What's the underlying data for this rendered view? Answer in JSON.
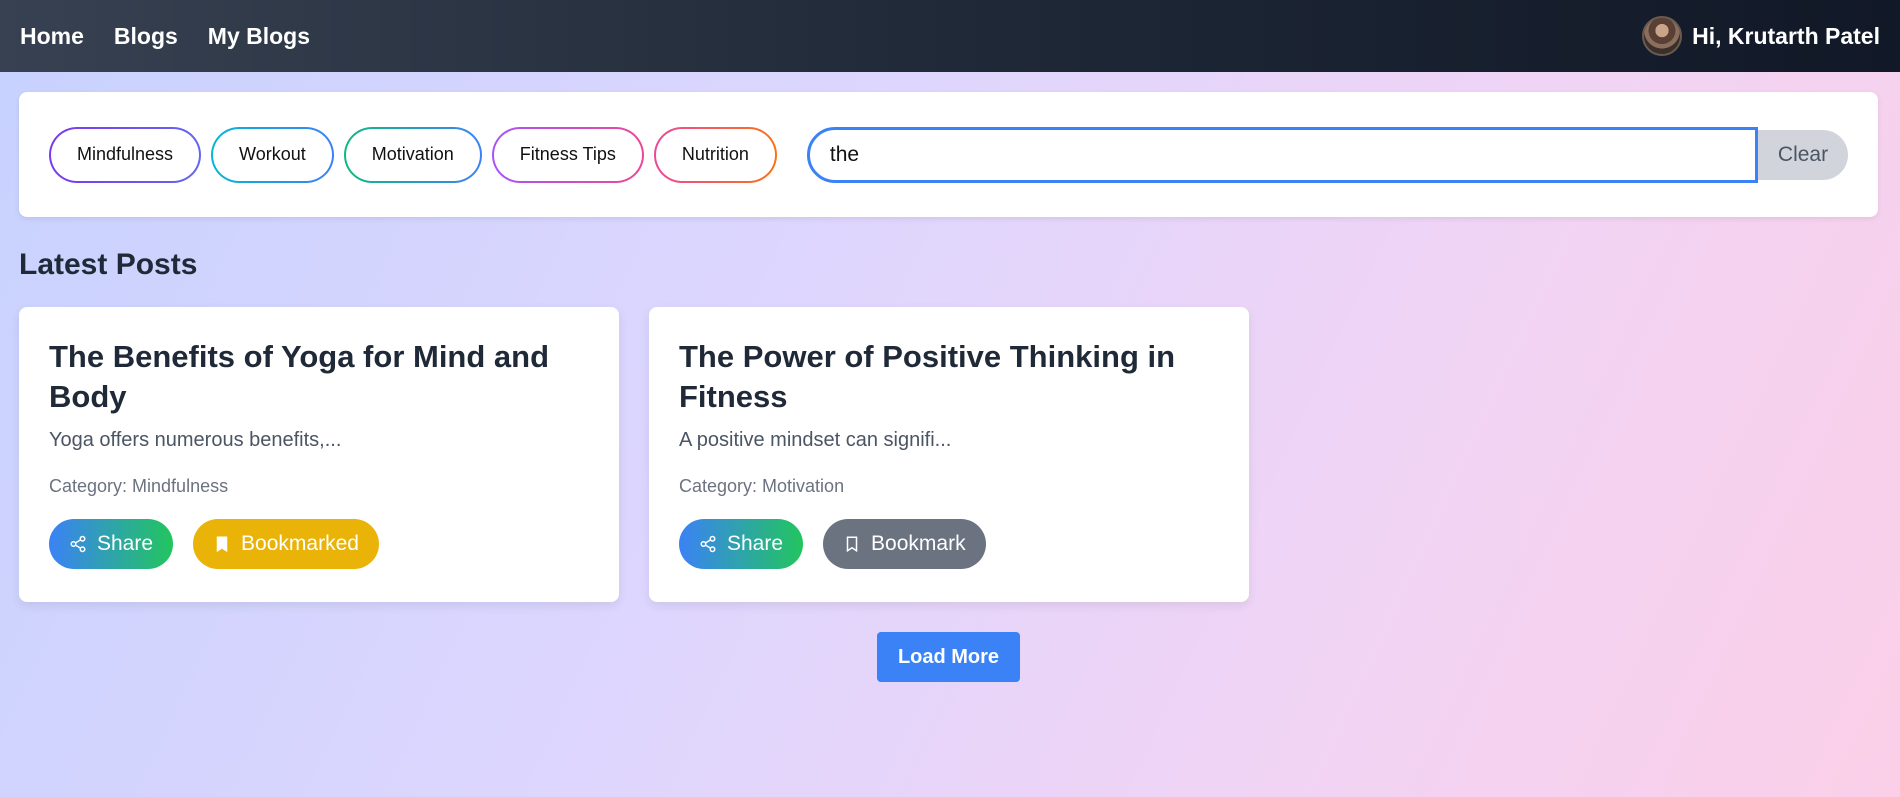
{
  "nav": {
    "links": [
      "Home",
      "Blogs",
      "My Blogs"
    ],
    "greeting": "Hi, Krutarth Patel"
  },
  "filters": {
    "categories": [
      "Mindfulness",
      "Workout",
      "Motivation",
      "Fitness Tips",
      "Nutrition"
    ],
    "search_value": "the",
    "clear_label": "Clear"
  },
  "section_title": "Latest Posts",
  "posts": [
    {
      "title": "The Benefits of Yoga for Mind and Body",
      "excerpt": "Yoga offers numerous benefits,...",
      "category": "Category: Mindfulness",
      "share_label": "Share",
      "bookmark_label": "Bookmarked",
      "bookmarked": true
    },
    {
      "title": "The Power of Positive Thinking in Fitness",
      "excerpt": "A positive mindset can signifi...",
      "category": "Category: Motivation",
      "share_label": "Share",
      "bookmark_label": "Bookmark",
      "bookmarked": false
    }
  ],
  "load_more_label": "Load More",
  "colors": {
    "accent": "#3b82f6",
    "bookmarked": "#eab308",
    "bookmark": "#6b7280"
  },
  "icons": {
    "share": "share-icon",
    "bookmark_filled": "bookmark-filled-icon",
    "bookmark_outline": "bookmark-outline-icon"
  }
}
